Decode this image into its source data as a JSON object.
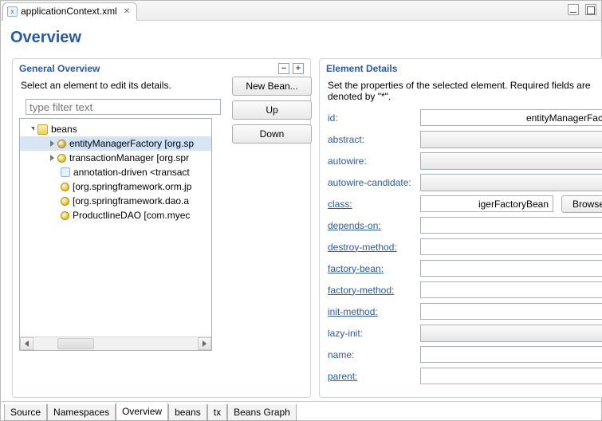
{
  "editorTab": {
    "title": "applicationContext.xml"
  },
  "page": {
    "title": "Overview"
  },
  "leftPanel": {
    "title": "General Overview",
    "subtitle": "Select an element to edit its details.",
    "filterPlaceholder": "type filter text",
    "tree": {
      "root": {
        "label": "beans",
        "children": [
          {
            "label": "entityManagerFactory [org.springframework...]",
            "display": "entityManagerFactory [org.sp",
            "selected": true,
            "expandable": true,
            "icon": "bean"
          },
          {
            "label": "transactionManager [org.springframework...]",
            "display": "transactionManager [org.spr",
            "selected": false,
            "expandable": true,
            "icon": "bean"
          },
          {
            "label": "annotation-driven <transaction...>",
            "display": "annotation-driven <transact",
            "selected": false,
            "expandable": false,
            "icon": "anno"
          },
          {
            "label": "[org.springframework.orm.jpa...]",
            "display": "[org.springframework.orm.jp",
            "selected": false,
            "expandable": false,
            "icon": "bean"
          },
          {
            "label": "[org.springframework.dao.annotation...]",
            "display": "[org.springframework.dao.a",
            "selected": false,
            "expandable": false,
            "icon": "bean"
          },
          {
            "label": "ProductlineDAO [com.myeclipse...]",
            "display": "ProductlineDAO [com.myec",
            "selected": false,
            "expandable": false,
            "icon": "bean"
          }
        ]
      }
    },
    "buttons": {
      "newBean": "New Bean...",
      "up": "Up",
      "down": "Down"
    }
  },
  "rightPanel": {
    "title": "Element Details",
    "subtitle": "Set the properties of the selected element. Required fields are denoted by \"*\".",
    "properties": [
      {
        "key": "id",
        "label": "id:",
        "type": "text",
        "link": false,
        "value": "entityManagerFactory",
        "display": "entityManagerFactory"
      },
      {
        "key": "abstract",
        "label": "abstract:",
        "type": "combo",
        "link": false,
        "value": ""
      },
      {
        "key": "autowire",
        "label": "autowire:",
        "type": "combo",
        "link": false,
        "value": ""
      },
      {
        "key": "autowire-candidate",
        "label": "autowire-candidate:",
        "type": "combo",
        "link": false,
        "value": ""
      },
      {
        "key": "class",
        "label": "class:",
        "type": "text-browse",
        "link": true,
        "value": "org.springframework.orm.jpa.LocalContainerEntityManagerFactoryBean",
        "display": "igerFactoryBean"
      },
      {
        "key": "depends-on",
        "label": "depends-on:",
        "type": "text",
        "link": true,
        "value": ""
      },
      {
        "key": "destroy-method",
        "label": "destroy-method:",
        "type": "text",
        "link": true,
        "value": ""
      },
      {
        "key": "factory-bean",
        "label": "factory-bean:",
        "type": "text",
        "link": true,
        "value": ""
      },
      {
        "key": "factory-method",
        "label": "factory-method:",
        "type": "text",
        "link": true,
        "value": ""
      },
      {
        "key": "init-method",
        "label": "init-method:",
        "type": "text",
        "link": true,
        "value": ""
      },
      {
        "key": "lazy-init",
        "label": "lazy-init:",
        "type": "combo",
        "link": false,
        "value": ""
      },
      {
        "key": "name",
        "label": "name:",
        "type": "text",
        "link": false,
        "value": ""
      },
      {
        "key": "parent",
        "label": "parent:",
        "type": "text",
        "link": true,
        "value": ""
      }
    ],
    "browseLabel": "Browse..."
  },
  "bottomTabs": [
    {
      "label": "Source",
      "active": false
    },
    {
      "label": "Namespaces",
      "active": false
    },
    {
      "label": "Overview",
      "active": true
    },
    {
      "label": "beans",
      "active": false
    },
    {
      "label": "tx",
      "active": false
    },
    {
      "label": "Beans Graph",
      "active": false
    }
  ]
}
